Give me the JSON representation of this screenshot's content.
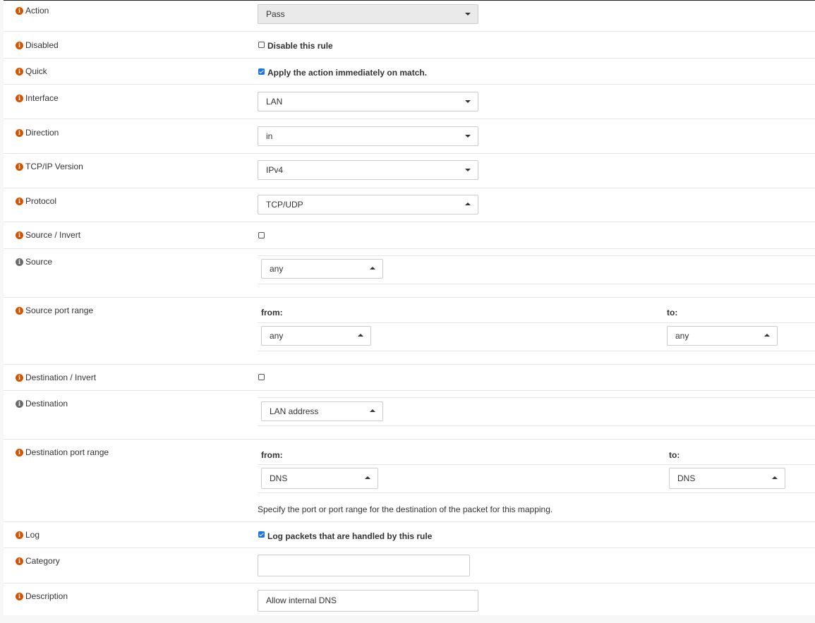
{
  "rows": {
    "action": {
      "label": "Action",
      "value": "Pass"
    },
    "disabled": {
      "label": "Disabled",
      "checkbox_label": "Disable this rule",
      "checked": false
    },
    "quick": {
      "label": "Quick",
      "checkbox_label": "Apply the action immediately on match.",
      "checked": true
    },
    "interface": {
      "label": "Interface",
      "value": "LAN"
    },
    "direction": {
      "label": "Direction",
      "value": "in"
    },
    "tcpip_version": {
      "label": "TCP/IP Version",
      "value": "IPv4"
    },
    "protocol": {
      "label": "Protocol",
      "value": "TCP/UDP"
    },
    "source_invert": {
      "label": "Source / Invert",
      "checked": false
    },
    "source": {
      "label": "Source",
      "value": "any"
    },
    "source_port_range": {
      "label": "Source port range",
      "from_label": "from:",
      "to_label": "to:",
      "from_value": "any",
      "to_value": "any"
    },
    "destination_invert": {
      "label": "Destination / Invert",
      "checked": false
    },
    "destination": {
      "label": "Destination",
      "value": "LAN address"
    },
    "destination_port_range": {
      "label": "Destination port range",
      "from_label": "from:",
      "to_label": "to:",
      "from_value": "DNS",
      "to_value": "DNS",
      "help": "Specify the port or port range for the destination of the packet for this mapping."
    },
    "log": {
      "label": "Log",
      "checkbox_label": "Log packets that are handled by this rule",
      "checked": true
    },
    "category": {
      "label": "Category",
      "value": ""
    },
    "description": {
      "label": "Description",
      "value": "Allow internal DNS"
    }
  },
  "icons": {
    "info": "info-icon",
    "info_glyph": "i"
  },
  "colors": {
    "info_icon": "#d35400",
    "info_icon_muted": "#6b6b6b",
    "checkbox_checked": "#1a73e8"
  }
}
